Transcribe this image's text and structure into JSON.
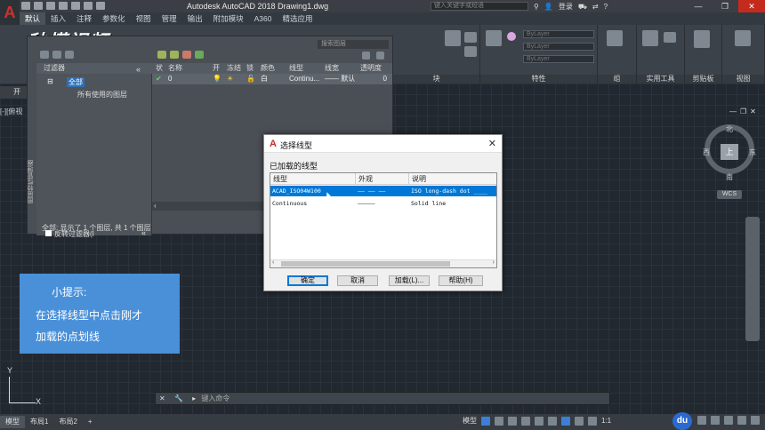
{
  "titlebar": {
    "app_letter": "A",
    "title": "Autodesk AutoCAD 2018    Drawing1.dwg",
    "search_placeholder": "键入关键字或短语",
    "login": "登录",
    "help": "?"
  },
  "ribbon_tabs": [
    "默认",
    "插入",
    "注释",
    "参数化",
    "视图",
    "管理",
    "输出",
    "附加模块",
    "A360",
    "精选应用"
  ],
  "ribbon_groups": [
    {
      "label": "块"
    },
    {
      "label": "特性"
    },
    {
      "label": "组"
    },
    {
      "label": "实用工具"
    },
    {
      "label": "剪贴板"
    },
    {
      "label": "视图"
    }
  ],
  "ribbon_combos": [
    "ByLayer",
    "ByLayer",
    "ByLayer"
  ],
  "watermark": "秒懂视频",
  "tab_start": "开",
  "viewport_label": "[-][俯视",
  "layer_panel": {
    "search_placeholder": "搜索图层",
    "filter_header": "过滤器",
    "tree_all": "全部",
    "tree_used": "所有使用的图层",
    "invert_filter": "反转过滤器(I",
    "status": "全部: 显示了 1 个图层, 共 1 个图层",
    "side_label": "图层特性管理器",
    "columns": [
      "状",
      "名称",
      "开",
      "冻结",
      "锁",
      "颜色",
      "线型",
      "线宽",
      "透明度"
    ],
    "row": {
      "name": "0",
      "color": "白",
      "linetype": "Continu...",
      "lineweight": "—— 默认",
      "transparency": "0"
    }
  },
  "hint": {
    "line1": "小提示:",
    "line2": "在选择线型中点击刚才",
    "line3": "加载的点划线"
  },
  "dialog": {
    "title": "选择线型",
    "section": "已加载的线型",
    "col_linetype": "线型",
    "col_appearance": "外观",
    "col_description": "说明",
    "rows": [
      {
        "linetype": "ACAD_ISO04W100",
        "description": "ISO long-dash dot ____"
      },
      {
        "linetype": "Continuous",
        "description": "Solid line"
      }
    ],
    "btn_ok": "确定",
    "btn_cancel": "取消",
    "btn_load": "加载(L)...",
    "btn_help": "帮助(H)"
  },
  "viewcube": {
    "top": "上",
    "north": "北",
    "south": "南",
    "east": "东",
    "west": "西",
    "wcs": "WCS"
  },
  "ucs": {
    "x": "X",
    "y": "Y"
  },
  "command": {
    "placeholder": "键入命令"
  },
  "statusbar": {
    "tabs": [
      "模型",
      "布局1",
      "布局2"
    ],
    "model_label": "模型",
    "scale": "1:1",
    "du": "du"
  },
  "colors": {
    "accent": "#0078d7",
    "hint_bg": "#4a90d9",
    "close": "#c42b1c"
  }
}
